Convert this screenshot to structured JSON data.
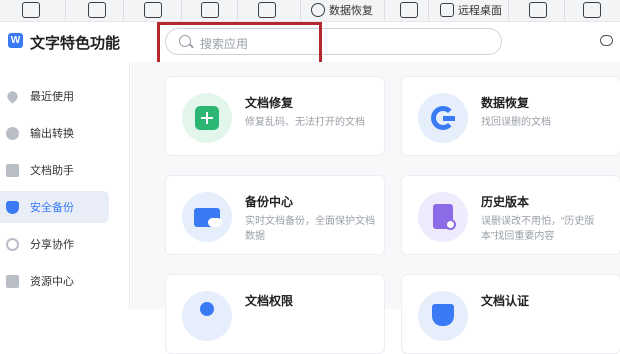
{
  "toolbar": {
    "items": [
      {
        "icon": "screen-record-icon",
        "label": ""
      },
      {
        "icon": "text-translate-icon",
        "label": ""
      },
      {
        "icon": "doc-search-icon",
        "label": ""
      },
      {
        "icon": "doc-edit-icon",
        "label": ""
      },
      {
        "icon": "star-doc-icon",
        "label": ""
      },
      {
        "icon": "data-recovery-icon",
        "label": "数据恢复"
      },
      {
        "icon": "remote-cam-icon",
        "label": ""
      },
      {
        "icon": "remote-desktop-icon",
        "label": "远程桌面"
      },
      {
        "icon": "user-card-icon",
        "label": ""
      },
      {
        "icon": "tools-icon",
        "label": ""
      }
    ]
  },
  "header": {
    "app_title": "文字特色功能",
    "logo_letter": "W"
  },
  "search": {
    "placeholder": "搜索应用"
  },
  "sidebar": {
    "items": [
      {
        "label": "最近使用",
        "icon": "heart-icon",
        "active": false
      },
      {
        "label": "输出转换",
        "icon": "convert-icon",
        "active": false
      },
      {
        "label": "文档助手",
        "icon": "bookmark-icon",
        "active": false
      },
      {
        "label": "安全备份",
        "icon": "shield-icon",
        "active": true
      },
      {
        "label": "分享协作",
        "icon": "share-icon",
        "active": false
      },
      {
        "label": "资源中心",
        "icon": "briefcase-icon",
        "active": false
      }
    ]
  },
  "cards": [
    {
      "title": "文档修复",
      "desc": "修复乱码、无法打开的文档",
      "icon": "doc-repair-icon",
      "color": "#2bb673",
      "bg": "#e3f6ec"
    },
    {
      "title": "数据恢复",
      "desc": "找回误删的文档",
      "icon": "data-recovery-g-icon",
      "color": "#3a7bf5",
      "bg": "#e6eefc"
    },
    {
      "title": "备份中心",
      "desc": "实时文档备份，全面保护文档数据",
      "icon": "backup-folder-icon",
      "color": "#3a7bf5",
      "bg": "#e6eefc"
    },
    {
      "title": "历史版本",
      "desc": "误删误改不用怕，“历史版本”找回重要内容",
      "icon": "history-version-icon",
      "color": "#8b6ce6",
      "bg": "#efeafc"
    },
    {
      "title": "文档权限",
      "desc": "",
      "icon": "doc-permission-icon",
      "color": "#3a7bf5",
      "bg": "#e6eefc"
    },
    {
      "title": "文档认证",
      "desc": "",
      "icon": "doc-cert-icon",
      "color": "#3a7bf5",
      "bg": "#e6eefc"
    }
  ]
}
